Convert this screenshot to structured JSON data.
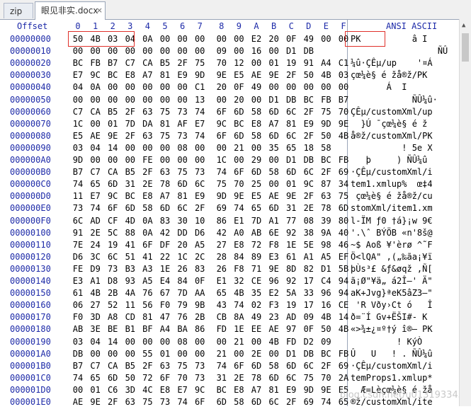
{
  "tabs": [
    {
      "label": "zip"
    },
    {
      "label": "眼见非实.docx",
      "close": "×"
    }
  ],
  "header": {
    "offset": "Offset",
    "cols": [
      "0",
      "1",
      "2",
      "3",
      "4",
      "5",
      "6",
      "7",
      "8",
      "9",
      "A",
      "B",
      "C",
      "D",
      "E",
      "F"
    ],
    "ansi": "ANSI ASCII"
  },
  "rows": [
    {
      "offset": "00000000",
      "hex": [
        "50",
        "4B",
        "03",
        "04",
        "0A",
        "00",
        "00",
        "00",
        "00",
        "00",
        "E2",
        "20",
        "0F",
        "49",
        "00",
        "00"
      ],
      "ascii": "PK          â I  "
    },
    {
      "offset": "00000010",
      "hex": [
        "00",
        "00",
        "00",
        "00",
        "00",
        "00",
        "00",
        "00",
        "09",
        "00",
        "16",
        "00",
        "D1",
        "DB"
      ],
      "ascii": "                 ÑÛ"
    },
    {
      "offset": "00000020",
      "hex": [
        "BC",
        "FB",
        "B7",
        "C7",
        "CA",
        "B5",
        "2F",
        "75",
        "70",
        "12",
        "00",
        "01",
        "19",
        "91",
        "A4",
        "C1"
      ],
      "ascii": "¼û·ÇÊµ/up    '¤Á"
    },
    {
      "offset": "00000030",
      "hex": [
        "E7",
        "9C",
        "BC",
        "E8",
        "A7",
        "81",
        "E9",
        "9D",
        "9E",
        "E5",
        "AE",
        "9E",
        "2F",
        "50",
        "4B",
        "03"
      ],
      "ascii": "çœ¼è§ é žå®ž/PK "
    },
    {
      "offset": "00000040",
      "hex": [
        "04",
        "0A",
        "00",
        "00",
        "00",
        "00",
        "00",
        "C1",
        "20",
        "0F",
        "49",
        "00",
        "00",
        "00",
        "00",
        "00"
      ],
      "ascii": "       Á  I     "
    },
    {
      "offset": "00000050",
      "hex": [
        "00",
        "00",
        "00",
        "00",
        "00",
        "00",
        "00",
        "13",
        "00",
        "20",
        "00",
        "D1",
        "DB",
        "BC",
        "FB",
        "B7"
      ],
      "ascii": "            ÑÛ¼û·"
    },
    {
      "offset": "00000060",
      "hex": [
        "C7",
        "CA",
        "B5",
        "2F",
        "63",
        "75",
        "73",
        "74",
        "6F",
        "6D",
        "58",
        "6D",
        "6C",
        "2F",
        "75",
        "70"
      ],
      "ascii": "ÇÊµ/customXml/up"
    },
    {
      "offset": "00000070",
      "hex": [
        "1C",
        "00",
        "01",
        "7D",
        "DA",
        "81",
        "AF",
        "E7",
        "9C",
        "BC",
        "E8",
        "A7",
        "81",
        "E9",
        "9D",
        "9E"
      ],
      "ascii": "  }Ú ¯çœ¼è§ é ž"
    },
    {
      "offset": "00000080",
      "hex": [
        "E5",
        "AE",
        "9E",
        "2F",
        "63",
        "75",
        "73",
        "74",
        "6F",
        "6D",
        "58",
        "6D",
        "6C",
        "2F",
        "50",
        "4B"
      ],
      "ascii": "å®ž/customXml/PK"
    },
    {
      "offset": "00000090",
      "hex": [
        "03",
        "04",
        "14",
        "00",
        "00",
        "00",
        "08",
        "00",
        "00",
        "21",
        "00",
        "35",
        "65",
        "18",
        "58"
      ],
      "ascii": "          ! 5e X"
    },
    {
      "offset": "000000A0",
      "hex": [
        "9D",
        "00",
        "00",
        "00",
        "FE",
        "00",
        "00",
        "00",
        "1C",
        "00",
        "29",
        "00",
        "D1",
        "DB",
        "BC",
        "FB"
      ],
      "ascii": "   þ     ) ÑÛ¼û"
    },
    {
      "offset": "000000B0",
      "hex": [
        "B7",
        "C7",
        "CA",
        "B5",
        "2F",
        "63",
        "75",
        "73",
        "74",
        "6F",
        "6D",
        "58",
        "6D",
        "6C",
        "2F",
        "69"
      ],
      "ascii": "·ÇÊµ/customXml/i"
    },
    {
      "offset": "000000C0",
      "hex": [
        "74",
        "65",
        "6D",
        "31",
        "2E",
        "78",
        "6D",
        "6C",
        "75",
        "70",
        "25",
        "00",
        "01",
        "9C",
        "87",
        "34"
      ],
      "ascii": "tem1.xmlup%  œ‡4"
    },
    {
      "offset": "000000D0",
      "hex": [
        "11",
        "E7",
        "9C",
        "BC",
        "E8",
        "A7",
        "81",
        "E9",
        "9D",
        "9E",
        "E5",
        "AE",
        "9E",
        "2F",
        "63",
        "75"
      ],
      "ascii": " çœ¼è§ é žå®ž/cu"
    },
    {
      "offset": "000000E0",
      "hex": [
        "73",
        "74",
        "6F",
        "6D",
        "58",
        "6D",
        "6C",
        "2F",
        "69",
        "74",
        "65",
        "6D",
        "31",
        "2E",
        "78",
        "6D"
      ],
      "ascii": "stomXml/item1.xm"
    },
    {
      "offset": "000000F0",
      "hex": [
        "6C",
        "AD",
        "CF",
        "4D",
        "0A",
        "83",
        "30",
        "10",
        "86",
        "E1",
        "7D",
        "A1",
        "77",
        "08",
        "39",
        "80"
      ],
      "ascii": "l-ÏM ƒ0 †á}¡w 9€"
    },
    {
      "offset": "00000100",
      "hex": [
        "91",
        "2E",
        "5C",
        "88",
        "0A",
        "42",
        "DD",
        "D6",
        "42",
        "A0",
        "AB",
        "6E",
        "92",
        "38",
        "9A",
        "40"
      ],
      "ascii": "'.\\ˆ BÝÖB «n'8š@"
    },
    {
      "offset": "00000110",
      "hex": [
        "7E",
        "24",
        "19",
        "41",
        "6F",
        "DF",
        "20",
        "A5",
        "27",
        "E8",
        "72",
        "F8",
        "1E",
        "5E",
        "98",
        "46"
      ],
      "ascii": "~$ Aoß ¥'èrø ^˜F"
    },
    {
      "offset": "00000120",
      "hex": [
        "D6",
        "3C",
        "6C",
        "51",
        "41",
        "22",
        "1C",
        "2C",
        "28",
        "84",
        "89",
        "E3",
        "61",
        "A1",
        "A5",
        "EF"
      ],
      "ascii": "Ö<lQA\" ,(„‰ãa¡¥ï"
    },
    {
      "offset": "00000130",
      "hex": [
        "FE",
        "D9",
        "73",
        "B3",
        "A3",
        "1E",
        "26",
        "83",
        "26",
        "F8",
        "71",
        "9E",
        "8D",
        "82",
        "D1",
        "5B"
      ],
      "ascii": "þÙs³£ &ƒ&øqž ‚Ñ["
    },
    {
      "offset": "00000140",
      "hex": [
        "E3",
        "A1",
        "D8",
        "93",
        "A5",
        "E4",
        "84",
        "0F",
        "E1",
        "32",
        "CE",
        "96",
        "92",
        "17",
        "C4",
        "94"
      ],
      "ascii": "ã¡Ø\"¥ä„ á2Î–' Ä\""
    },
    {
      "offset": "00000150",
      "hex": [
        "61",
        "4B",
        "2B",
        "4A",
        "76",
        "67",
        "7D",
        "AA",
        "65",
        "4B",
        "35",
        "E2",
        "5A",
        "33",
        "96",
        "94"
      ],
      "ascii": "aK+Jvg}ªeK5âZ3–\""
    },
    {
      "offset": "00000160",
      "hex": [
        "06",
        "27",
        "52",
        "11",
        "56",
        "F0",
        "79",
        "9B",
        "43",
        "74",
        "02",
        "F3",
        "19",
        "17",
        "16",
        "CE"
      ],
      "ascii": " 'R Vðy›Ct ó   Î"
    },
    {
      "offset": "00000170",
      "hex": [
        "F0",
        "3D",
        "A8",
        "CD",
        "81",
        "47",
        "76",
        "2B",
        "CB",
        "8A",
        "49",
        "23",
        "AD",
        "09",
        "4B",
        "14"
      ],
      "ascii": "ð=¨Í Gv+ËŠI#- K"
    },
    {
      "offset": "00000180",
      "hex": [
        "AB",
        "3E",
        "BE",
        "B1",
        "BF",
        "A4",
        "BA",
        "86",
        "FD",
        "1E",
        "EE",
        "AE",
        "97",
        "0F",
        "50",
        "4B"
      ],
      "ascii": "«>¾±¿¤º†ý î®— PK"
    },
    {
      "offset": "00000190",
      "hex": [
        "03",
        "04",
        "14",
        "00",
        "00",
        "00",
        "08",
        "00",
        "00",
        "21",
        "00",
        "4B",
        "FD",
        "D2",
        "09"
      ],
      "ascii": "         ! KýÒ"
    },
    {
      "offset": "000001A0",
      "hex": [
        "DB",
        "00",
        "00",
        "00",
        "55",
        "01",
        "00",
        "00",
        "21",
        "00",
        "2E",
        "00",
        "D1",
        "DB",
        "BC",
        "FB"
      ],
      "ascii": "Û   U   ! . ÑÛ¼û"
    },
    {
      "offset": "000001B0",
      "hex": [
        "B7",
        "C7",
        "CA",
        "B5",
        "2F",
        "63",
        "75",
        "73",
        "74",
        "6F",
        "6D",
        "58",
        "6D",
        "6C",
        "2F",
        "69"
      ],
      "ascii": "·ÇÊµ/customXml/i"
    },
    {
      "offset": "000001C0",
      "hex": [
        "74",
        "65",
        "6D",
        "50",
        "72",
        "6F",
        "70",
        "73",
        "31",
        "2E",
        "78",
        "6D",
        "6C",
        "75",
        "70",
        "2A"
      ],
      "ascii": "temProps1.xmlup*"
    },
    {
      "offset": "000001D0",
      "hex": [
        "00",
        "01",
        "C6",
        "3D",
        "4C",
        "E8",
        "E7",
        "9C",
        "BC",
        "E8",
        "A7",
        "81",
        "E9",
        "9D",
        "9E",
        "E5"
      ],
      "ascii": "  Æ=Lèçœ¼è§ é žå"
    },
    {
      "offset": "000001E0",
      "hex": [
        "AE",
        "9E",
        "2F",
        "63",
        "75",
        "73",
        "74",
        "6F",
        "6D",
        "58",
        "6D",
        "6C",
        "2F",
        "69",
        "74",
        "65"
      ],
      "ascii": "®ž/customXml/ite"
    }
  ],
  "watermark": "blog.csdn.net/u013193343",
  "colors": {
    "offset": "#1d2aa8",
    "highlight": "#e0302a"
  }
}
